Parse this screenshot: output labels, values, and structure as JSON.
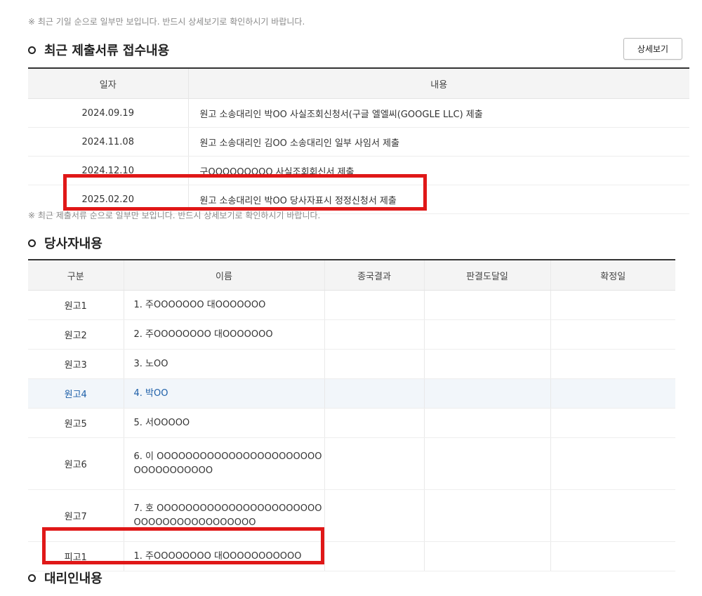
{
  "top_note": "※ 최근 기일 순으로 일부만 보입니다. 반드시 상세보기로 확인하시기 바랍니다.",
  "submissions": {
    "title": "최근 제출서류 접수내용",
    "detail_button": "상세보기",
    "headers": {
      "date": "일자",
      "content": "내용"
    },
    "rows": [
      {
        "date": "2024.09.19",
        "content": "원고 소송대리인 박OO 사실조회신청서(구글 엘엘씨(GOOGLE LLC) 제출"
      },
      {
        "date": "2024.11.08",
        "content": "원고 소송대리인 김OO 소송대리인 일부 사임서 제출"
      },
      {
        "date": "2024.12.10",
        "content": "구OOOOOOOOO 사실조회회신서 제출"
      },
      {
        "date": "2025.02.20",
        "content": "원고 소송대리인 박OO 당사자표시 정정신청서 제출"
      }
    ],
    "note": "※ 최근 제출서류 순으로 일부만 보입니다. 반드시 상세보기로 확인하시기 바랍니다."
  },
  "parties": {
    "title": "당사자내용",
    "headers": {
      "category": "구분",
      "name": "이름",
      "result": "종국결과",
      "service_date": "판결도달일",
      "finalized_date": "확정일"
    },
    "rows": [
      {
        "category": "원고1",
        "name": "1. 주OOOOOOO 대OOOOOOO"
      },
      {
        "category": "원고2",
        "name": "2. 주OOOOOOOO 대OOOOOOO"
      },
      {
        "category": "원고3",
        "name": "3. 노OO"
      },
      {
        "category": "원고4",
        "name": "4. 박OO"
      },
      {
        "category": "원고5",
        "name": "5. 서OOOOO"
      },
      {
        "category": "원고6",
        "name": "6. 이 OOOOOOOOOOOOOOOOOOOOOOOOOOOOOOOOOO"
      },
      {
        "category": "원고7",
        "name": "7. 호 OOOOOOOOOOOOOOOOOOOOOOOOOOOOOOOOOOOOOOOO"
      },
      {
        "category": "피고1",
        "name": "1. 주OOOOOOOO 대OOOOOOOOOOO"
      }
    ]
  },
  "agents": {
    "title": "대리인내용"
  },
  "colors": {
    "highlight_text": "#1d5fa8",
    "annotation_box": "#e01818"
  }
}
